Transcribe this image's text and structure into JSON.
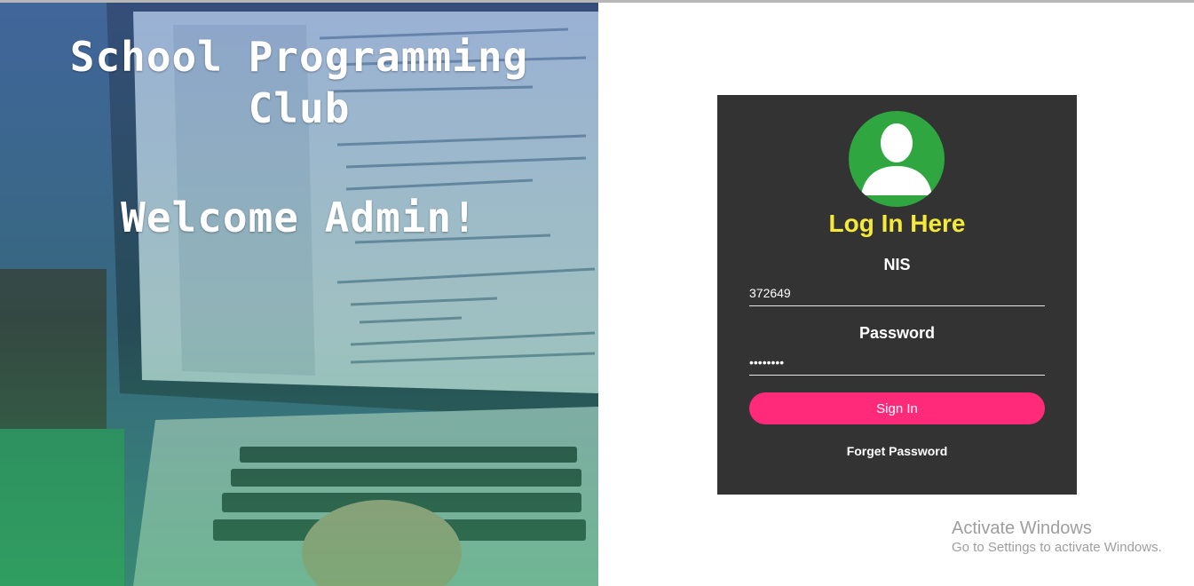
{
  "hero": {
    "title": "School Programming Club",
    "welcome": "Welcome Admin!"
  },
  "login": {
    "title": "Log In Here",
    "nis_label": "NIS",
    "nis_value": "372649",
    "password_label": "Password",
    "password_value": "••••••••",
    "signin_label": "Sign In",
    "forget_label": "Forget Password",
    "avatar_icon": "user-icon"
  },
  "watermark": {
    "line1": "Activate Windows",
    "line2": "Go to Settings to activate Windows."
  },
  "colors": {
    "card_bg": "#333333",
    "title_yellow": "#f5e93a",
    "avatar_green": "#2fa63f",
    "signin_pink": "#ff2a7a"
  }
}
